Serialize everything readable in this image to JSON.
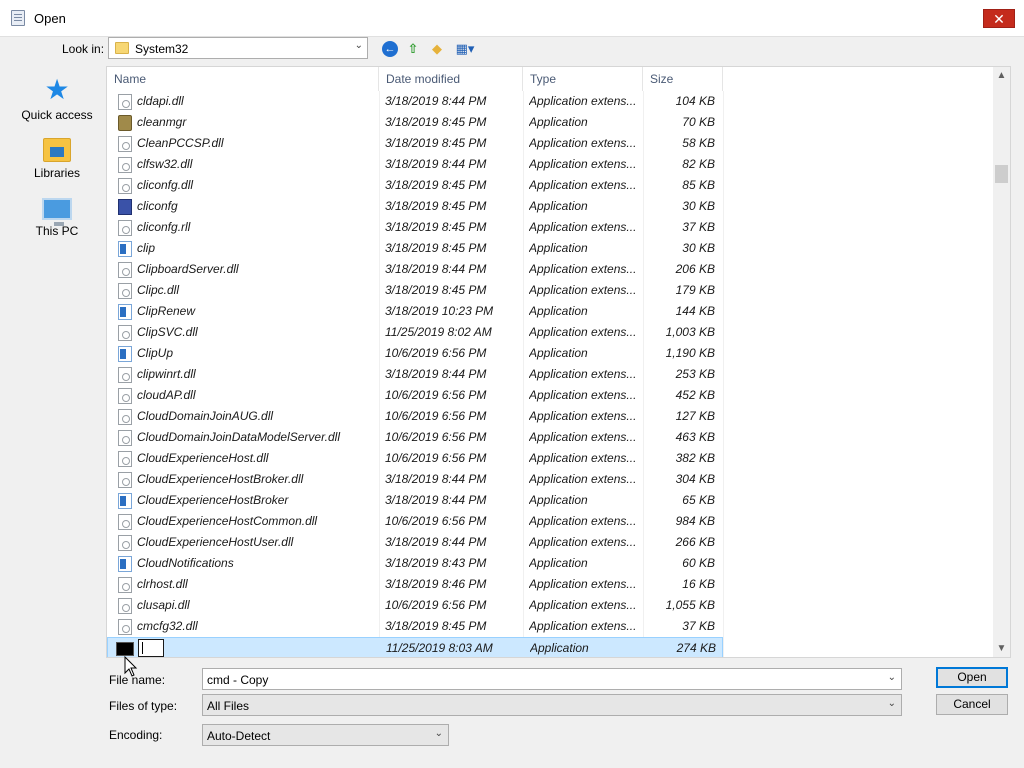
{
  "window": {
    "title": "Open",
    "close_glyph": "✕"
  },
  "toolbar": {
    "lookin_label": "Look in:",
    "lookin_value": "System32",
    "icons": [
      "back-icon",
      "up-folder-icon",
      "new-folder-icon",
      "view-menu-icon"
    ]
  },
  "places": [
    {
      "label": "Quick access",
      "icon": "star-icon"
    },
    {
      "label": "Libraries",
      "icon": "libraries-icon"
    },
    {
      "label": "This PC",
      "icon": "computer-icon"
    }
  ],
  "list": {
    "columns": {
      "name": "Name",
      "date": "Date modified",
      "type": "Type",
      "size": "Size"
    },
    "rows": [
      {
        "name": "cldapi.dll",
        "date": "3/18/2019 8:44 PM",
        "type": "Application extens...",
        "size": "104 KB",
        "icon": "dll"
      },
      {
        "name": "cleanmgr",
        "date": "3/18/2019 8:45 PM",
        "type": "Application",
        "size": "70 KB",
        "icon": "clean"
      },
      {
        "name": "CleanPCCSP.dll",
        "date": "3/18/2019 8:45 PM",
        "type": "Application extens...",
        "size": "58 KB",
        "icon": "dll"
      },
      {
        "name": "clfsw32.dll",
        "date": "3/18/2019 8:44 PM",
        "type": "Application extens...",
        "size": "82 KB",
        "icon": "dll"
      },
      {
        "name": "cliconfg.dll",
        "date": "3/18/2019 8:45 PM",
        "type": "Application extens...",
        "size": "85 KB",
        "icon": "dll"
      },
      {
        "name": "cliconfg",
        "date": "3/18/2019 8:45 PM",
        "type": "Application",
        "size": "30 KB",
        "icon": "cliconfg"
      },
      {
        "name": "cliconfg.rll",
        "date": "3/18/2019 8:45 PM",
        "type": "Application extens...",
        "size": "37 KB",
        "icon": "dll"
      },
      {
        "name": "clip",
        "date": "3/18/2019 8:45 PM",
        "type": "Application",
        "size": "30 KB",
        "icon": "app"
      },
      {
        "name": "ClipboardServer.dll",
        "date": "3/18/2019 8:44 PM",
        "type": "Application extens...",
        "size": "206 KB",
        "icon": "dll"
      },
      {
        "name": "Clipc.dll",
        "date": "3/18/2019 8:45 PM",
        "type": "Application extens...",
        "size": "179 KB",
        "icon": "dll"
      },
      {
        "name": "ClipRenew",
        "date": "3/18/2019 10:23 PM",
        "type": "Application",
        "size": "144 KB",
        "icon": "app"
      },
      {
        "name": "ClipSVC.dll",
        "date": "11/25/2019 8:02 AM",
        "type": "Application extens...",
        "size": "1,003 KB",
        "icon": "dll"
      },
      {
        "name": "ClipUp",
        "date": "10/6/2019 6:56 PM",
        "type": "Application",
        "size": "1,190 KB",
        "icon": "app"
      },
      {
        "name": "clipwinrt.dll",
        "date": "3/18/2019 8:44 PM",
        "type": "Application extens...",
        "size": "253 KB",
        "icon": "dll"
      },
      {
        "name": "cloudAP.dll",
        "date": "10/6/2019 6:56 PM",
        "type": "Application extens...",
        "size": "452 KB",
        "icon": "dll"
      },
      {
        "name": "CloudDomainJoinAUG.dll",
        "date": "10/6/2019 6:56 PM",
        "type": "Application extens...",
        "size": "127 KB",
        "icon": "dll"
      },
      {
        "name": "CloudDomainJoinDataModelServer.dll",
        "date": "10/6/2019 6:56 PM",
        "type": "Application extens...",
        "size": "463 KB",
        "icon": "dll"
      },
      {
        "name": "CloudExperienceHost.dll",
        "date": "10/6/2019 6:56 PM",
        "type": "Application extens...",
        "size": "382 KB",
        "icon": "dll"
      },
      {
        "name": "CloudExperienceHostBroker.dll",
        "date": "3/18/2019 8:44 PM",
        "type": "Application extens...",
        "size": "304 KB",
        "icon": "dll"
      },
      {
        "name": "CloudExperienceHostBroker",
        "date": "3/18/2019 8:44 PM",
        "type": "Application",
        "size": "65 KB",
        "icon": "app"
      },
      {
        "name": "CloudExperienceHostCommon.dll",
        "date": "10/6/2019 6:56 PM",
        "type": "Application extens...",
        "size": "984 KB",
        "icon": "dll"
      },
      {
        "name": "CloudExperienceHostUser.dll",
        "date": "3/18/2019 8:44 PM",
        "type": "Application extens...",
        "size": "266 KB",
        "icon": "dll"
      },
      {
        "name": "CloudNotifications",
        "date": "3/18/2019 8:43 PM",
        "type": "Application",
        "size": "60 KB",
        "icon": "app"
      },
      {
        "name": "clrhost.dll",
        "date": "3/18/2019 8:46 PM",
        "type": "Application extens...",
        "size": "16 KB",
        "icon": "dll"
      },
      {
        "name": "clusapi.dll",
        "date": "10/6/2019 6:56 PM",
        "type": "Application extens...",
        "size": "1,055 KB",
        "icon": "dll"
      },
      {
        "name": "cmcfg32.dll",
        "date": "3/18/2019 8:45 PM",
        "type": "Application extens...",
        "size": "37 KB",
        "icon": "dll"
      },
      {
        "name": "",
        "date": "11/25/2019 8:03 AM",
        "type": "Application",
        "size": "274 KB",
        "icon": "cmd",
        "selected": true,
        "renaming": true
      }
    ]
  },
  "form": {
    "filename_label_pre": "File ",
    "filename_label_rest": "name:",
    "filename_value": "cmd - Copy",
    "filetype_label": "Files of type:",
    "filetype_value": "All Files",
    "encoding_label": "Encoding:",
    "encoding_value": "Auto-Detect",
    "open_label": "Open",
    "cancel_label": "Cancel"
  }
}
